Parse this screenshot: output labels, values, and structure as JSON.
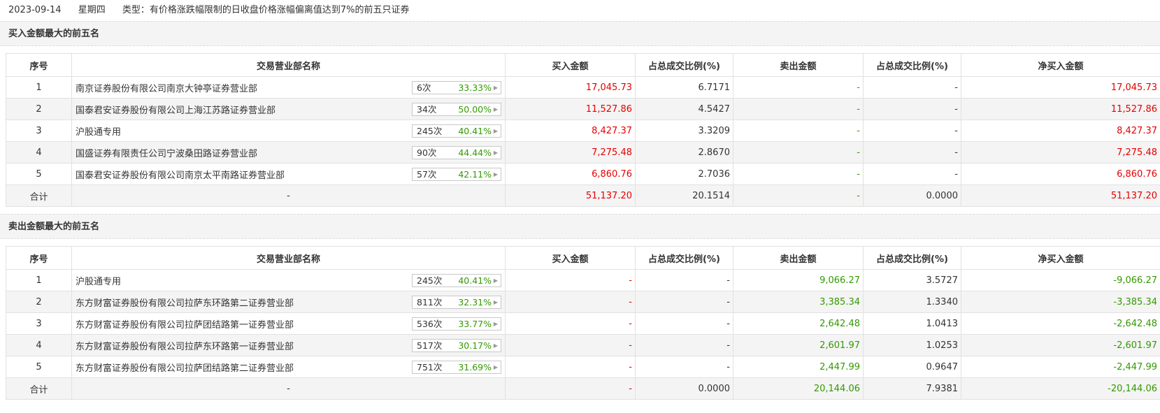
{
  "header": {
    "date": "2023-09-14",
    "weekday": "星期四",
    "type_label": "类型：有价格涨跌幅限制的日收盘价格涨幅偏离值达到7%的前五只证券"
  },
  "colors": {
    "positive": "#e60000",
    "negative": "#339900",
    "row_alt": "#f4f4f4"
  },
  "columns": [
    "序号",
    "交易营业部名称",
    "买入金额",
    "占总成交比例(%)",
    "卖出金额",
    "占总成交比例(%)",
    "净买入金额"
  ],
  "buy_section": {
    "title": "买入金额最大的前五名",
    "rows": [
      {
        "idx": "1",
        "name": "南京证券股份有限公司南京大钟亭证券营业部",
        "count": "6次",
        "pct": "33.33%",
        "buy": "17,045.73",
        "buy_ratio": "6.7171",
        "sell": "-",
        "sell_ratio": "-",
        "net": "17,045.73"
      },
      {
        "idx": "2",
        "name": "国泰君安证券股份有限公司上海江苏路证券营业部",
        "count": "34次",
        "pct": "50.00%",
        "buy": "11,527.86",
        "buy_ratio": "4.5427",
        "sell": "-",
        "sell_ratio": "-",
        "net": "11,527.86"
      },
      {
        "idx": "3",
        "name": "沪股通专用",
        "count": "245次",
        "pct": "40.41%",
        "buy": "8,427.37",
        "buy_ratio": "3.3209",
        "sell": "-",
        "sell_ratio": "-",
        "net": "8,427.37"
      },
      {
        "idx": "4",
        "name": "国盛证券有限责任公司宁波桑田路证券营业部",
        "count": "90次",
        "pct": "44.44%",
        "buy": "7,275.48",
        "buy_ratio": "2.8670",
        "sell": "-",
        "sell_ratio": "-",
        "net": "7,275.48"
      },
      {
        "idx": "5",
        "name": "国泰君安证券股份有限公司南京太平南路证券营业部",
        "count": "57次",
        "pct": "42.11%",
        "buy": "6,860.76",
        "buy_ratio": "2.7036",
        "sell": "-",
        "sell_ratio": "-",
        "net": "6,860.76"
      }
    ],
    "total": {
      "label": "合计",
      "name": "-",
      "buy": "51,137.20",
      "buy_ratio": "20.1514",
      "sell": "-",
      "sell_ratio": "0.0000",
      "net": "51,137.20"
    }
  },
  "sell_section": {
    "title": "卖出金额最大的前五名",
    "rows": [
      {
        "idx": "1",
        "name": "沪股通专用",
        "count": "245次",
        "pct": "40.41%",
        "buy": "-",
        "buy_ratio": "-",
        "sell": "9,066.27",
        "sell_ratio": "3.5727",
        "net": "-9,066.27"
      },
      {
        "idx": "2",
        "name": "东方财富证券股份有限公司拉萨东环路第二证券营业部",
        "count": "811次",
        "pct": "32.31%",
        "buy": "-",
        "buy_ratio": "-",
        "sell": "3,385.34",
        "sell_ratio": "1.3340",
        "net": "-3,385.34"
      },
      {
        "idx": "3",
        "name": "东方财富证券股份有限公司拉萨团结路第一证券营业部",
        "count": "536次",
        "pct": "33.77%",
        "buy": "-",
        "buy_ratio": "-",
        "sell": "2,642.48",
        "sell_ratio": "1.0413",
        "net": "-2,642.48"
      },
      {
        "idx": "4",
        "name": "东方财富证券股份有限公司拉萨东环路第一证券营业部",
        "count": "517次",
        "pct": "30.17%",
        "buy": "-",
        "buy_ratio": "-",
        "sell": "2,601.97",
        "sell_ratio": "1.0253",
        "net": "-2,601.97"
      },
      {
        "idx": "5",
        "name": "东方财富证券股份有限公司拉萨团结路第二证券营业部",
        "count": "751次",
        "pct": "31.69%",
        "buy": "-",
        "buy_ratio": "-",
        "sell": "2,447.99",
        "sell_ratio": "0.9647",
        "net": "-2,447.99"
      }
    ],
    "total": {
      "label": "合计",
      "name": "-",
      "buy": "-",
      "buy_ratio": "0.0000",
      "sell": "20,144.06",
      "sell_ratio": "7.9381",
      "net": "-20,144.06"
    }
  }
}
